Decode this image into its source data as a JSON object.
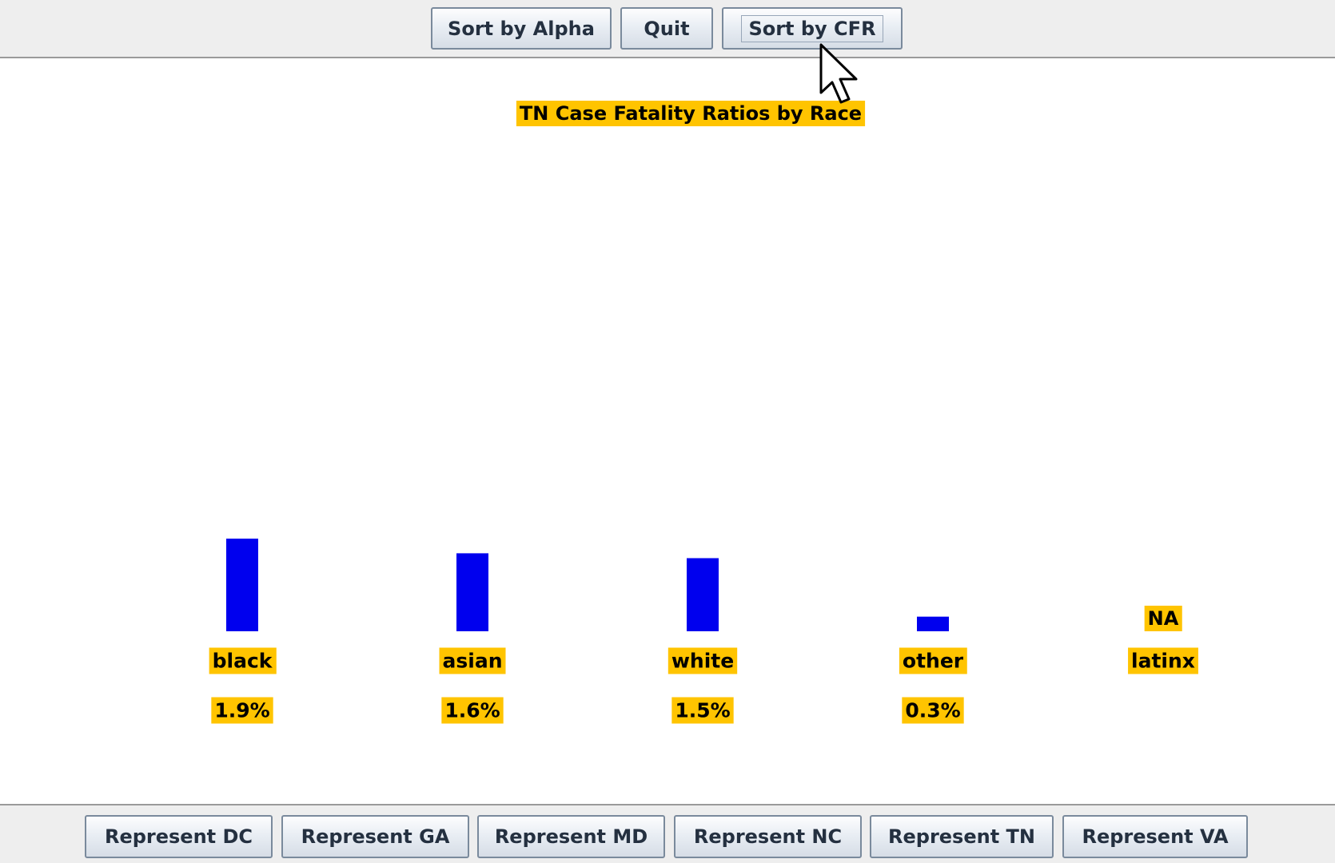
{
  "toolbar": {
    "sort_alpha_label": "Sort by Alpha",
    "quit_label": "Quit",
    "sort_cfr_label": "Sort by CFR"
  },
  "bottom_buttons": [
    "Represent DC",
    "Represent GA",
    "Represent MD",
    "Represent NC",
    "Represent TN",
    "Represent VA"
  ],
  "colors": {
    "bar": "#0000ee",
    "label_bg": "#ffc400",
    "label_text": "#000000"
  },
  "cursor_icon": "arrow-cursor-icon",
  "chart_data": {
    "type": "bar",
    "title": "TN Case Fatality Ratios by Race",
    "categories": [
      "black",
      "asian",
      "white",
      "other",
      "latinx"
    ],
    "values": [
      1.9,
      1.6,
      1.5,
      0.3,
      null
    ],
    "value_labels": [
      "1.9%",
      "1.6%",
      "1.5%",
      "0.3%",
      ""
    ],
    "missing_label": "NA",
    "unit": "%",
    "grid": false
  }
}
